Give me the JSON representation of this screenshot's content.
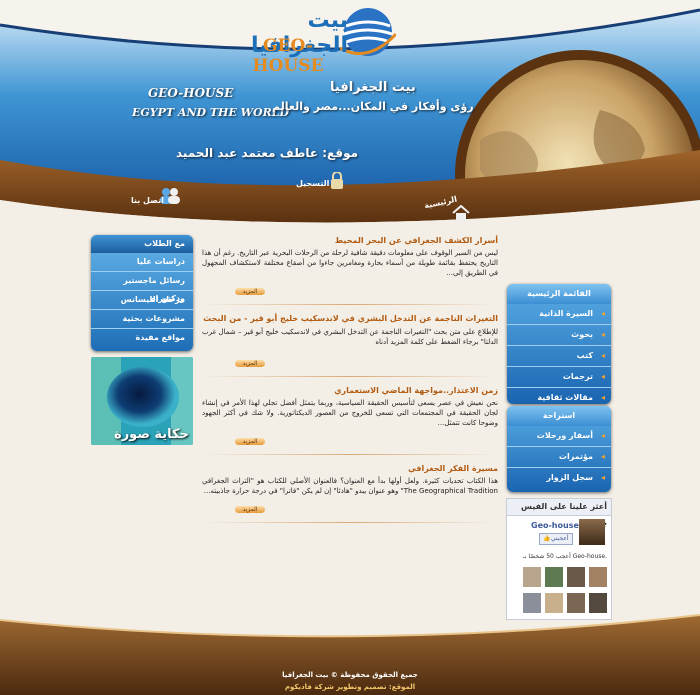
{
  "header": {
    "logo_arabic": "بيت الجغرافيا",
    "logo_english": "GEO-HOUSE",
    "left_line1": "GEO-HOUSE",
    "left_line2": "EGYPT AND THE WORLD",
    "right_title": "بيت الجغرافيا",
    "right_tagline": "رؤى وأفكار في المكان...مصر والعالم",
    "author": "موقع: عاطف معتمد عبد الحميد"
  },
  "nav": {
    "home": "الرئيسية",
    "register": "التسجيل",
    "contact": "اتصل بنا"
  },
  "left_panel": {
    "title": "مع الطلاب",
    "items": [
      "دراسات عليا",
      "رسائل ماجستير ودكتوراه",
      "مرحلة الليسانس",
      "مشروعات بحثية",
      "مواقع مفيدة"
    ]
  },
  "photo_story": {
    "label": "حكاية صورة"
  },
  "articles": [
    {
      "title": "أسرار الكشف الجغرافي عن البحر المحيط",
      "body": "ليس من السير الوقوف على معلومات دقيقة شافية لرحلة من الرحلات البحرية عبر التاريخ. رغم أن هذا التاريخ يحتفظ بقائمة طويلة من أسماء بحارة ومغامرين جاءوا من أصقاع مختلفة لاستكشاف المجهول في الطريق إلى...",
      "more": "المزيد"
    },
    {
      "title": "التغيرات الناجمة عن التدخل البشري في لاندسكيب خليج أبو قير - من البحث",
      "body": "للإطلاع على متن بحث \"التغيرات الناجمة عن التدخل البشري في لاندسكيب خليج أبو قير – شمال غرب الدلتا\" برجاء الضغط على كلمة المزيد أدناه",
      "more": "المزيد"
    },
    {
      "title": "زمن الاعتذار..مواجهة الماضي الاستعماري",
      "body": "نحن نعيش في عصر يسعى لتأسيس الحقيقة السياسية، وربما يتمثل أفضل تجلي لهذا الأمر في إنشاء لجان الحقيقة في المجتمعات التي تسعى للخروج من العصور الديكتاتورية. ولا شك في أكثر الجهود وضوحا كانت تتمثل...",
      "more": "المزيد"
    },
    {
      "title": "مسيرة الفكر الجغرافي",
      "body": "هذا الكتاب تحديات كثيرة. ولعل أولها بدأ مع العنوان؟ فالعنوان الأصلي للكتاب هو \"التراث الجغرافي The Geographical Tradition\" وهو عنوان يبدو \"هادئا\" إن لم يكن \"فاترا\" في درجة حرارة جاذبيته...",
      "more": "المزيد"
    }
  ],
  "main_menu": {
    "title": "القائمة الرئيسية",
    "items": [
      "السيرة الذاتية",
      "بحوث",
      "كتب",
      "ترجمات",
      "مقالات ثقافية"
    ]
  },
  "rest_menu": {
    "title": "استراحة",
    "items": [
      "أسفار ورحلات",
      "مؤتمرات",
      "سجل الزوار"
    ]
  },
  "facebook": {
    "title": "أعثر علينا على الفيس بوك",
    "page_name": "Geo-house",
    "like_label": "أعجبني",
    "fans_text": "أعجب 50 شخصًا بـ Geo-house."
  },
  "footer": {
    "copyright": "جميع الحقوق محفوظة © بيت الجغرافيا",
    "credits": "الموقع: تصميم وتطوير شركة فاديكوم"
  },
  "colors": {
    "blue": "#1d6eb6",
    "brown": "#6b3a12",
    "orange": "#e38b21",
    "title": "#b25b12"
  }
}
